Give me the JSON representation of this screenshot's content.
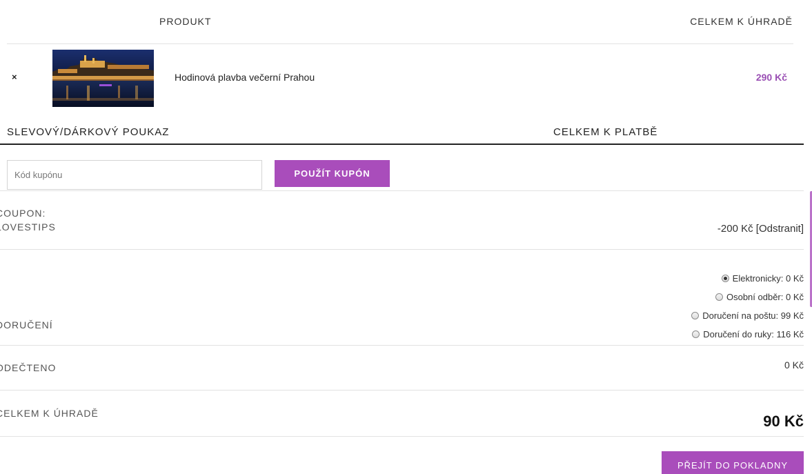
{
  "cart_table": {
    "col_product": "PRODUKT",
    "col_total": "CELKEM K ÚHRADĚ",
    "item": {
      "remove_symbol": "×",
      "name": "Hodinová plavba večerní Prahou",
      "price": "290 Kč"
    }
  },
  "coupon": {
    "title": "SLEVOVÝ/DÁRKOVÝ POUKAZ",
    "placeholder": "Kód kupónu",
    "apply_label": "POUŽÍT KUPÓN"
  },
  "totals": {
    "title": "CELKEM K PLATBĚ",
    "coupon_line1": "COUPON:",
    "coupon_line2": "LOVESTIPS",
    "coupon_amount": "-200 Kč",
    "coupon_remove": "[Odstranit]",
    "shipping_label": "DORUČENÍ",
    "shipping_options": [
      {
        "label": "Elektronicky: 0 Kč",
        "checked": true
      },
      {
        "label": "Osobní odběr: 0 Kč",
        "checked": false
      },
      {
        "label": "Doručení na poštu: 99 Kč",
        "checked": false
      },
      {
        "label": "Doručení do ruky: 116 Kč",
        "checked": false
      }
    ],
    "deducted_label": "ODEČTENO",
    "deducted_value": "0 Kč",
    "grand_label": "CELKEM K ÚHRADĚ",
    "grand_value": "90 Kč",
    "checkout_label": "PŘEJÍT DO POKLADNY"
  },
  "colors": {
    "accent": "#a94dbb",
    "price": "#9a4fb4"
  }
}
